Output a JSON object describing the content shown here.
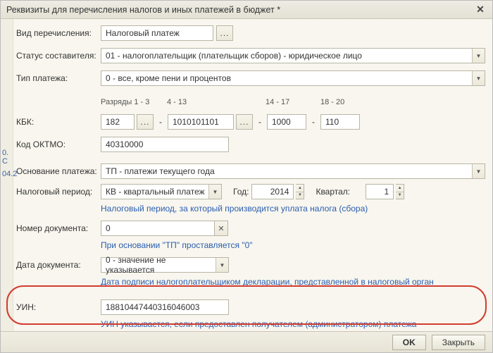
{
  "window": {
    "title": "Реквизиты для перечисления налогов и иных платежей в бюджет *"
  },
  "labels": {
    "vid": "Вид перечисления:",
    "status": "Статус составителя:",
    "tip": "Тип платежа:",
    "kbk": "КБК:",
    "oktmo": "Код ОКТМО:",
    "osn": "Основание платежа:",
    "period": "Налоговый период:",
    "god": "Год:",
    "kvartal": "Квартал:",
    "nomer": "Номер документа:",
    "data": "Дата документа:",
    "uin": "УИН:"
  },
  "values": {
    "vid": "Налоговый платеж",
    "status": "01 - налогоплательщик (плательщик сборов) - юридическое лицо",
    "tip": "0 - все, кроме пени и процентов",
    "kbk1": "182",
    "kbk2": "1010101101",
    "kbk3": "1000",
    "kbk4": "110",
    "oktmo": "40310000",
    "osn": "ТП - платежи текущего года",
    "period": "КВ - квартальный платеж",
    "god": "2014",
    "kvartal": "1",
    "nomer": "0",
    "data": "0 - значение не указывается",
    "uin": "18810447440316046003"
  },
  "headers": {
    "kbk1": "Разряды 1 - 3",
    "kbk2": "4 - 13",
    "kbk3": "14 - 17",
    "kbk4": "18 - 20"
  },
  "hints": {
    "period": "Налоговый период, за который производится уплата налога (сбора)",
    "nomer": "При основании \"ТП\" проставляется \"0\"",
    "data": "Дата подписи налогоплательщиком декларации, представленной в налоговый орган",
    "uin": "УИН указывается, если предоставлен получателем (администратором) платежа"
  },
  "buttons": {
    "ok": "OK",
    "close": "Закрыть"
  },
  "side": {
    "a": "0. С",
    "b": "04.2"
  },
  "icons": {
    "ellipsis": "...",
    "caret": "▼",
    "x": "✕",
    "up": "▲",
    "dn": "▼",
    "dash": "-"
  }
}
